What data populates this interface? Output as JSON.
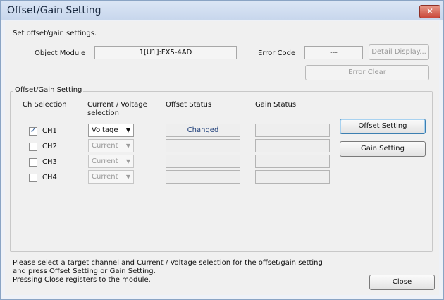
{
  "window": {
    "title": "Offset/Gain Setting",
    "close_glyph": "✕"
  },
  "header": {
    "instruction": "Set offset/gain settings.",
    "object_module_label": "Object Module",
    "object_module_value": "1[U1]:FX5-4AD",
    "error_code_label": "Error Code",
    "error_code_value": "---",
    "detail_display_button": "Detail Display...",
    "error_clear_button": "Error Clear"
  },
  "group": {
    "title": "Offset/Gain Setting",
    "col_ch_selection": "Ch Selection",
    "col_current_voltage": "Current / Voltage\nselection",
    "col_offset_status": "Offset Status",
    "col_gain_status": "Gain Status",
    "channels": [
      {
        "label": "CH1",
        "checked": true,
        "checkmark": "✓",
        "selection": "Voltage",
        "enabled": true,
        "offset_status": "Changed",
        "gain_status": ""
      },
      {
        "label": "CH2",
        "checked": false,
        "checkmark": "",
        "selection": "Current",
        "enabled": false,
        "offset_status": "",
        "gain_status": ""
      },
      {
        "label": "CH3",
        "checked": false,
        "checkmark": "",
        "selection": "Current",
        "enabled": false,
        "offset_status": "",
        "gain_status": ""
      },
      {
        "label": "CH4",
        "checked": false,
        "checkmark": "",
        "selection": "Current",
        "enabled": false,
        "offset_status": "",
        "gain_status": ""
      }
    ],
    "offset_setting_button": "Offset Setting",
    "gain_setting_button": "Gain Setting"
  },
  "footer": {
    "note_line1": "Please select a target channel and Current / Voltage selection for the offset/gain setting",
    "note_line2": "and press Offset Setting or Gain Setting.",
    "note_line3": "Pressing Close registers to the module.",
    "close_button": "Close"
  },
  "icons": {
    "dropdown_arrow": "▼"
  },
  "colors": {
    "title_bar": "#c7d6ec",
    "close_button": "#c9473a",
    "status_text": "#1f3f7a"
  }
}
